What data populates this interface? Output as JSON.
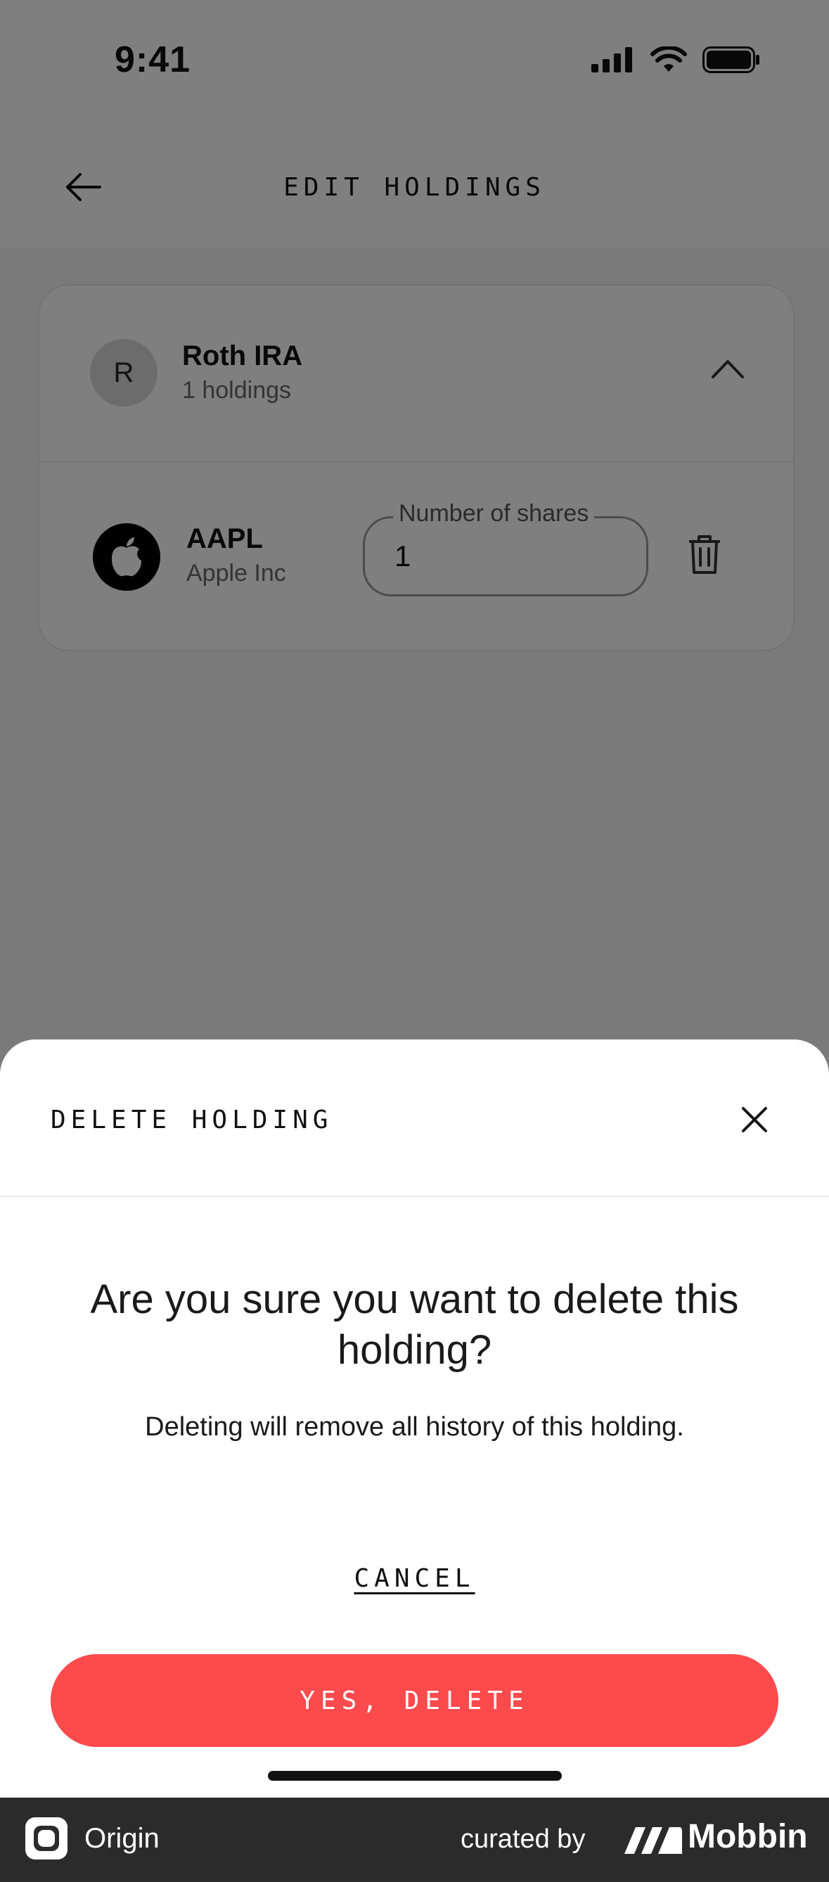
{
  "status_bar": {
    "time": "9:41"
  },
  "header": {
    "title": "EDIT HOLDINGS"
  },
  "account": {
    "initial": "R",
    "name": "Roth IRA",
    "subtitle": "1 holdings"
  },
  "holding": {
    "ticker": "AAPL",
    "company": "Apple Inc",
    "shares_label": "Number of shares",
    "shares_value": "1"
  },
  "sheet": {
    "title": "DELETE HOLDING",
    "heading": "Are you sure you want to delete this holding?",
    "body": "Deleting will remove all history of this holding.",
    "cancel_label": "CANCEL",
    "confirm_label": "YES, DELETE"
  },
  "footer": {
    "app_name": "Origin",
    "curated_by": "curated by",
    "brand": "Mobbin"
  },
  "colors": {
    "danger": "#fc4a4d",
    "overlay": "rgba(0,0,0,0.5)",
    "footer_bg": "#2b2b2b"
  },
  "icons": [
    "back-arrow-icon",
    "chevron-up-icon",
    "apple-logo-icon",
    "trash-icon",
    "close-icon",
    "signal-icon",
    "wifi-icon",
    "battery-icon"
  ]
}
